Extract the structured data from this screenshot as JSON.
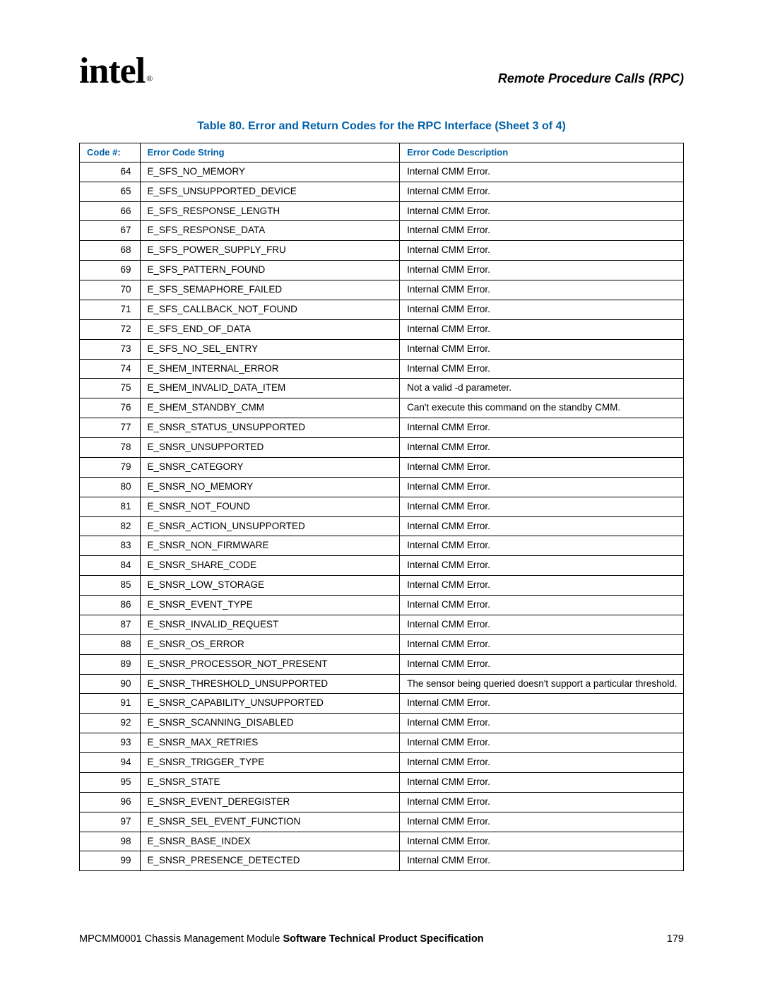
{
  "header": {
    "logo_text": "intel",
    "registered": "®",
    "section_title": "Remote Procedure Calls (RPC)"
  },
  "table": {
    "caption": "Table 80. Error and Return Codes for the RPC Interface (Sheet 3 of 4)",
    "headers": {
      "code": "Code #:",
      "string": "Error Code String",
      "desc": "Error Code Description"
    },
    "rows": [
      {
        "code": "64",
        "string": "E_SFS_NO_MEMORY",
        "desc": "Internal CMM Error."
      },
      {
        "code": "65",
        "string": "E_SFS_UNSUPPORTED_DEVICE",
        "desc": "Internal CMM Error."
      },
      {
        "code": "66",
        "string": "E_SFS_RESPONSE_LENGTH",
        "desc": "Internal CMM Error."
      },
      {
        "code": "67",
        "string": "E_SFS_RESPONSE_DATA",
        "desc": "Internal CMM Error."
      },
      {
        "code": "68",
        "string": "E_SFS_POWER_SUPPLY_FRU",
        "desc": "Internal CMM Error."
      },
      {
        "code": "69",
        "string": "E_SFS_PATTERN_FOUND",
        "desc": "Internal CMM Error."
      },
      {
        "code": "70",
        "string": "E_SFS_SEMAPHORE_FAILED",
        "desc": "Internal CMM Error."
      },
      {
        "code": "71",
        "string": "E_SFS_CALLBACK_NOT_FOUND",
        "desc": "Internal CMM Error."
      },
      {
        "code": "72",
        "string": "E_SFS_END_OF_DATA",
        "desc": "Internal CMM Error."
      },
      {
        "code": "73",
        "string": "E_SFS_NO_SEL_ENTRY",
        "desc": "Internal CMM Error."
      },
      {
        "code": "74",
        "string": "E_SHEM_INTERNAL_ERROR",
        "desc": "Internal CMM Error."
      },
      {
        "code": "75",
        "string": "E_SHEM_INVALID_DATA_ITEM",
        "desc": "Not a valid -d parameter."
      },
      {
        "code": "76",
        "string": "E_SHEM_STANDBY_CMM",
        "desc": "Can't execute this command on the standby CMM."
      },
      {
        "code": "77",
        "string": "E_SNSR_STATUS_UNSUPPORTED",
        "desc": "Internal CMM Error."
      },
      {
        "code": "78",
        "string": "E_SNSR_UNSUPPORTED",
        "desc": "Internal CMM Error."
      },
      {
        "code": "79",
        "string": "E_SNSR_CATEGORY",
        "desc": "Internal CMM Error."
      },
      {
        "code": "80",
        "string": "E_SNSR_NO_MEMORY",
        "desc": "Internal CMM Error."
      },
      {
        "code": "81",
        "string": "E_SNSR_NOT_FOUND",
        "desc": "Internal CMM Error."
      },
      {
        "code": "82",
        "string": "E_SNSR_ACTION_UNSUPPORTED",
        "desc": "Internal CMM Error."
      },
      {
        "code": "83",
        "string": "E_SNSR_NON_FIRMWARE",
        "desc": "Internal CMM Error."
      },
      {
        "code": "84",
        "string": "E_SNSR_SHARE_CODE",
        "desc": "Internal CMM Error."
      },
      {
        "code": "85",
        "string": "E_SNSR_LOW_STORAGE",
        "desc": "Internal CMM Error."
      },
      {
        "code": "86",
        "string": "E_SNSR_EVENT_TYPE",
        "desc": "Internal CMM Error."
      },
      {
        "code": "87",
        "string": "E_SNSR_INVALID_REQUEST",
        "desc": "Internal CMM Error."
      },
      {
        "code": "88",
        "string": "E_SNSR_OS_ERROR",
        "desc": "Internal CMM Error."
      },
      {
        "code": "89",
        "string": "E_SNSR_PROCESSOR_NOT_PRESENT",
        "desc": "Internal CMM Error."
      },
      {
        "code": "90",
        "string": "E_SNSR_THRESHOLD_UNSUPPORTED",
        "desc": "The sensor being queried doesn't support a particular threshold."
      },
      {
        "code": "91",
        "string": "E_SNSR_CAPABILITY_UNSUPPORTED",
        "desc": "Internal CMM Error."
      },
      {
        "code": "92",
        "string": "E_SNSR_SCANNING_DISABLED",
        "desc": "Internal CMM Error."
      },
      {
        "code": "93",
        "string": "E_SNSR_MAX_RETRIES",
        "desc": "Internal CMM Error."
      },
      {
        "code": "94",
        "string": "E_SNSR_TRIGGER_TYPE",
        "desc": "Internal CMM Error."
      },
      {
        "code": "95",
        "string": "E_SNSR_STATE",
        "desc": "Internal CMM Error."
      },
      {
        "code": "96",
        "string": "E_SNSR_EVENT_DEREGISTER",
        "desc": "Internal CMM Error."
      },
      {
        "code": "97",
        "string": "E_SNSR_SEL_EVENT_FUNCTION",
        "desc": "Internal CMM Error."
      },
      {
        "code": "98",
        "string": "E_SNSR_BASE_INDEX",
        "desc": "Internal CMM Error."
      },
      {
        "code": "99",
        "string": "E_SNSR_PRESENCE_DETECTED",
        "desc": "Internal CMM Error."
      }
    ]
  },
  "footer": {
    "doc_prefix": "MPCMM0001 Chassis Management Module ",
    "doc_bold": "Software Technical Product Specification",
    "page_number": "179"
  }
}
